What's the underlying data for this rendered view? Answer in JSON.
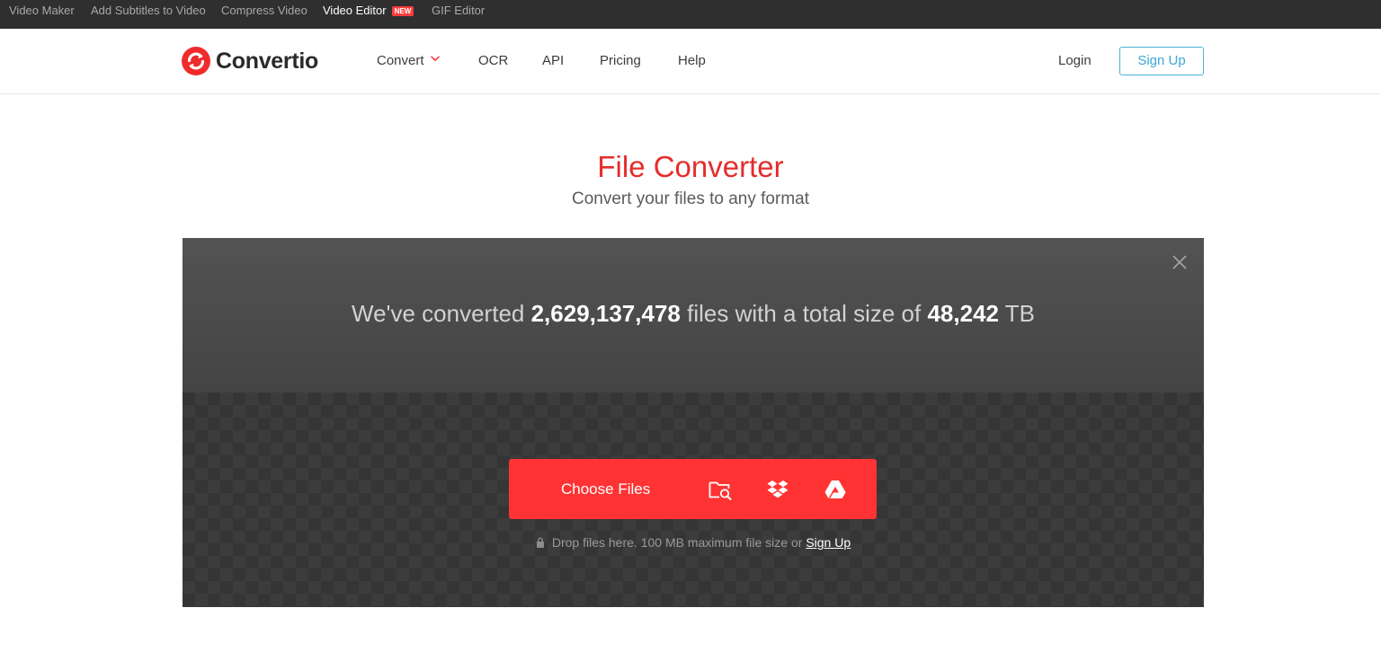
{
  "topbar": {
    "links": [
      {
        "label": "Video Maker"
      },
      {
        "label": "Add Subtitles to Video"
      },
      {
        "label": "Compress Video"
      },
      {
        "label": "Video Editor",
        "badge": "NEW"
      },
      {
        "label": "GIF Editor"
      }
    ]
  },
  "header": {
    "logo_text": "Convertio",
    "nav": [
      "Convert",
      "OCR",
      "API",
      "Pricing",
      "Help"
    ],
    "login_label": "Login",
    "signup_label": "Sign Up"
  },
  "hero": {
    "title": "File Converter",
    "subtitle": "Convert your files to any format"
  },
  "converter": {
    "stats_prefix": "We've converted",
    "files_count": "2,629,137,478",
    "stats_middle": "files with a total size of",
    "total_size": "48,242",
    "size_unit": "TB",
    "choose_label": "Choose Files",
    "drop_text": "Drop files here. 100 MB maximum file size or",
    "signup_link": "Sign Up"
  },
  "colors": {
    "brand_red": "#ff3333",
    "title_red": "#e52c2c",
    "signup_blue": "#3aa8d3",
    "topbar_bg": "#2f2f2f"
  },
  "icons": [
    "logo-icon",
    "chevron-down-icon",
    "close-icon",
    "folder-search-icon",
    "dropbox-icon",
    "google-drive-icon",
    "lock-icon"
  ]
}
